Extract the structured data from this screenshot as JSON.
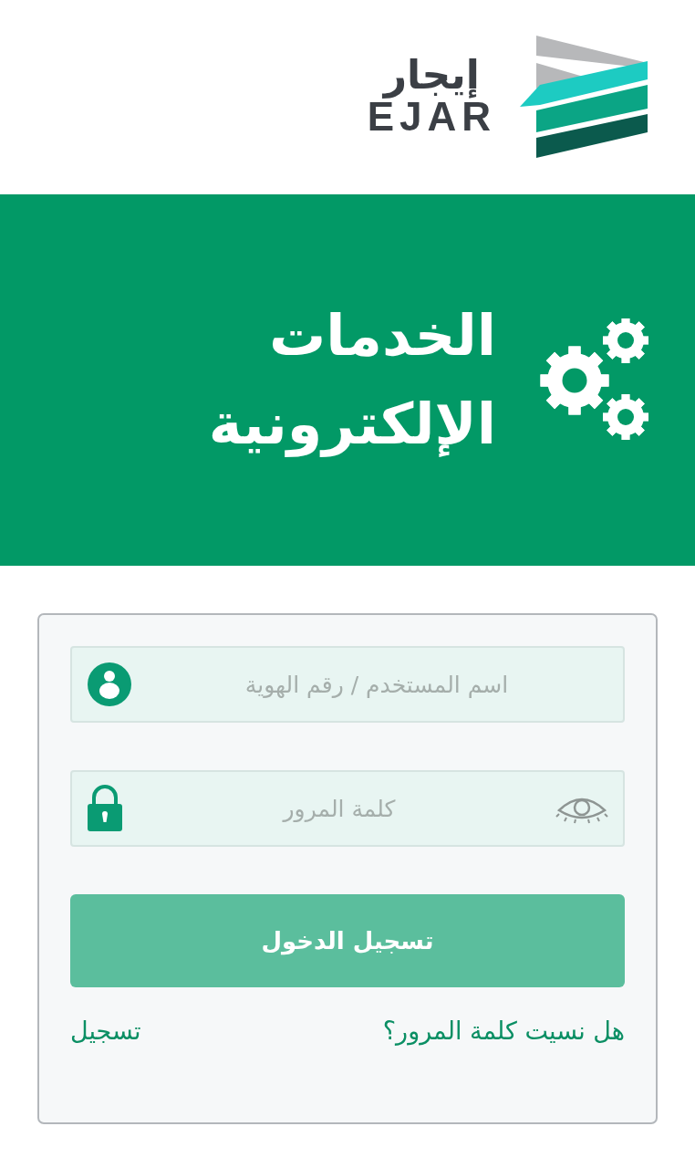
{
  "logo": {
    "arabic": "إيجار",
    "latin": "EJAR"
  },
  "banner": {
    "title": "الخدمات الإلكترونية"
  },
  "login": {
    "fields": [
      {
        "kind": "user",
        "placeholder": "اسم المستخدم / رقم الهوية"
      },
      {
        "kind": "password",
        "placeholder": "كلمة المرور"
      }
    ],
    "submit": "تسجيل الدخول",
    "forgot_link": "هل نسيت كلمة المرور؟",
    "register_link": "تسجيل"
  }
}
